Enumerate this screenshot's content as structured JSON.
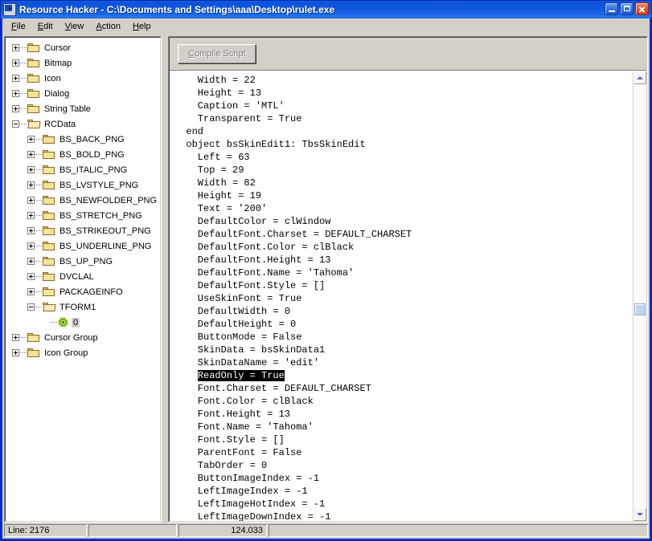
{
  "window": {
    "title": "Resource Hacker  -  C:\\Documents and Settings\\aaa\\Desktop\\rulet.exe",
    "icon": "app-icon",
    "buttons": {
      "minimize": "minimize-icon",
      "maximize": "maximize-icon",
      "close": "close-icon"
    },
    "accent_titlebar": "#0b52d8",
    "face": "#d4d0c8"
  },
  "menubar": {
    "items": [
      {
        "label": "File",
        "accel": "F"
      },
      {
        "label": "Edit",
        "accel": "E"
      },
      {
        "label": "View",
        "accel": "V"
      },
      {
        "label": "Action",
        "accel": "A"
      },
      {
        "label": "Help",
        "accel": "H"
      }
    ]
  },
  "tree": {
    "nodes": [
      {
        "label": "Cursor",
        "depth": 0,
        "expander": "plus",
        "icon": "folder-closed-icon",
        "selected": false
      },
      {
        "label": "Bitmap",
        "depth": 0,
        "expander": "plus",
        "icon": "folder-closed-icon",
        "selected": false
      },
      {
        "label": "Icon",
        "depth": 0,
        "expander": "plus",
        "icon": "folder-closed-icon",
        "selected": false
      },
      {
        "label": "Dialog",
        "depth": 0,
        "expander": "plus",
        "icon": "folder-closed-icon",
        "selected": false
      },
      {
        "label": "String Table",
        "depth": 0,
        "expander": "plus",
        "icon": "folder-closed-icon",
        "selected": false
      },
      {
        "label": "RCData",
        "depth": 0,
        "expander": "minus",
        "icon": "folder-open-icon",
        "selected": false
      },
      {
        "label": "BS_BACK_PNG",
        "depth": 1,
        "expander": "plus",
        "icon": "folder-closed-icon",
        "selected": false
      },
      {
        "label": "BS_BOLD_PNG",
        "depth": 1,
        "expander": "plus",
        "icon": "folder-closed-icon",
        "selected": false
      },
      {
        "label": "BS_ITALIC_PNG",
        "depth": 1,
        "expander": "plus",
        "icon": "folder-closed-icon",
        "selected": false
      },
      {
        "label": "BS_LVSTYLE_PNG",
        "depth": 1,
        "expander": "plus",
        "icon": "folder-closed-icon",
        "selected": false
      },
      {
        "label": "BS_NEWFOLDER_PNG",
        "depth": 1,
        "expander": "plus",
        "icon": "folder-closed-icon",
        "selected": false
      },
      {
        "label": "BS_STRETCH_PNG",
        "depth": 1,
        "expander": "plus",
        "icon": "folder-closed-icon",
        "selected": false
      },
      {
        "label": "BS_STRIKEOUT_PNG",
        "depth": 1,
        "expander": "plus",
        "icon": "folder-closed-icon",
        "selected": false
      },
      {
        "label": "BS_UNDERLINE_PNG",
        "depth": 1,
        "expander": "plus",
        "icon": "folder-closed-icon",
        "selected": false
      },
      {
        "label": "BS_UP_PNG",
        "depth": 1,
        "expander": "plus",
        "icon": "folder-closed-icon",
        "selected": false
      },
      {
        "label": "DVCLAL",
        "depth": 1,
        "expander": "plus",
        "icon": "folder-closed-icon",
        "selected": false
      },
      {
        "label": "PACKAGEINFO",
        "depth": 1,
        "expander": "plus",
        "icon": "folder-closed-icon",
        "selected": false
      },
      {
        "label": "TFORM1",
        "depth": 1,
        "expander": "minus",
        "icon": "folder-open-icon",
        "selected": false
      },
      {
        "label": "0",
        "depth": 2,
        "expander": "none",
        "icon": "gear-icon",
        "selected": true
      },
      {
        "label": "Cursor Group",
        "depth": 0,
        "expander": "plus",
        "icon": "folder-closed-icon",
        "selected": false
      },
      {
        "label": "Icon Group",
        "depth": 0,
        "expander": "plus",
        "icon": "folder-closed-icon",
        "selected": false
      }
    ]
  },
  "toolbar": {
    "compile_label_accel": "C",
    "compile_label_rest": "ompile Script",
    "compile_enabled": false
  },
  "editor": {
    "lines": [
      {
        "text": "    Width = 22",
        "selected": false
      },
      {
        "text": "    Height = 13",
        "selected": false
      },
      {
        "text": "    Caption = 'MTL'",
        "selected": false
      },
      {
        "text": "    Transparent = True",
        "selected": false
      },
      {
        "text": "  end",
        "selected": false
      },
      {
        "text": "  object bsSkinEdit1: TbsSkinEdit",
        "selected": false
      },
      {
        "text": "    Left = 63",
        "selected": false
      },
      {
        "text": "    Top = 29",
        "selected": false
      },
      {
        "text": "    Width = 82",
        "selected": false
      },
      {
        "text": "    Height = 19",
        "selected": false
      },
      {
        "text": "    Text = '200'",
        "selected": false
      },
      {
        "text": "    DefaultColor = clWindow",
        "selected": false
      },
      {
        "text": "    DefaultFont.Charset = DEFAULT_CHARSET",
        "selected": false
      },
      {
        "text": "    DefaultFont.Color = clBlack",
        "selected": false
      },
      {
        "text": "    DefaultFont.Height = 13",
        "selected": false
      },
      {
        "text": "    DefaultFont.Name = 'Tahoma'",
        "selected": false
      },
      {
        "text": "    DefaultFont.Style = []",
        "selected": false
      },
      {
        "text": "    UseSkinFont = True",
        "selected": false
      },
      {
        "text": "    DefaultWidth = 0",
        "selected": false
      },
      {
        "text": "    DefaultHeight = 0",
        "selected": false
      },
      {
        "text": "    ButtonMode = False",
        "selected": false
      },
      {
        "text": "    SkinData = bsSkinData1",
        "selected": false
      },
      {
        "text": "    SkinDataName = 'edit'",
        "selected": false
      },
      {
        "text": "    ReadOnly = True",
        "selected": true
      },
      {
        "text": "    Font.Charset = DEFAULT_CHARSET",
        "selected": false
      },
      {
        "text": "    Font.Color = clBlack",
        "selected": false
      },
      {
        "text": "    Font.Height = 13",
        "selected": false
      },
      {
        "text": "    Font.Name = 'Tahoma'",
        "selected": false
      },
      {
        "text": "    Font.Style = []",
        "selected": false
      },
      {
        "text": "    ParentFont = False",
        "selected": false
      },
      {
        "text": "    TabOrder = 0",
        "selected": false
      },
      {
        "text": "    ButtonImageIndex = -1",
        "selected": false
      },
      {
        "text": "    LeftImageIndex = -1",
        "selected": false
      },
      {
        "text": "    LeftImageHotIndex = -1",
        "selected": false
      },
      {
        "text": "    LeftImageDownIndex = -1",
        "selected": false
      }
    ],
    "selection_text": "ReadOnly = True",
    "selection_bg": "#000000",
    "selection_fg": "#ffffff"
  },
  "scrollbar": {
    "up_icon": "scroll-up-arrow-icon",
    "down_icon": "scroll-down-arrow-icon",
    "thumb_top_pct": 53
  },
  "statusbar": {
    "panel1": "Line: 2176",
    "panel2": "",
    "panel3": "124.033",
    "panel4": ""
  }
}
